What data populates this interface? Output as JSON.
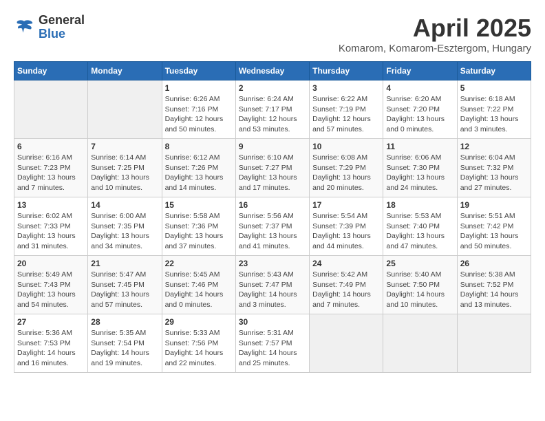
{
  "logo": {
    "general": "General",
    "blue": "Blue"
  },
  "header": {
    "month_year": "April 2025",
    "location": "Komarom, Komarom-Esztergom, Hungary"
  },
  "weekdays": [
    "Sunday",
    "Monday",
    "Tuesday",
    "Wednesday",
    "Thursday",
    "Friday",
    "Saturday"
  ],
  "weeks": [
    [
      {
        "day": "",
        "info": ""
      },
      {
        "day": "",
        "info": ""
      },
      {
        "day": "1",
        "info": "Sunrise: 6:26 AM\nSunset: 7:16 PM\nDaylight: 12 hours\nand 50 minutes."
      },
      {
        "day": "2",
        "info": "Sunrise: 6:24 AM\nSunset: 7:17 PM\nDaylight: 12 hours\nand 53 minutes."
      },
      {
        "day": "3",
        "info": "Sunrise: 6:22 AM\nSunset: 7:19 PM\nDaylight: 12 hours\nand 57 minutes."
      },
      {
        "day": "4",
        "info": "Sunrise: 6:20 AM\nSunset: 7:20 PM\nDaylight: 13 hours\nand 0 minutes."
      },
      {
        "day": "5",
        "info": "Sunrise: 6:18 AM\nSunset: 7:22 PM\nDaylight: 13 hours\nand 3 minutes."
      }
    ],
    [
      {
        "day": "6",
        "info": "Sunrise: 6:16 AM\nSunset: 7:23 PM\nDaylight: 13 hours\nand 7 minutes."
      },
      {
        "day": "7",
        "info": "Sunrise: 6:14 AM\nSunset: 7:25 PM\nDaylight: 13 hours\nand 10 minutes."
      },
      {
        "day": "8",
        "info": "Sunrise: 6:12 AM\nSunset: 7:26 PM\nDaylight: 13 hours\nand 14 minutes."
      },
      {
        "day": "9",
        "info": "Sunrise: 6:10 AM\nSunset: 7:27 PM\nDaylight: 13 hours\nand 17 minutes."
      },
      {
        "day": "10",
        "info": "Sunrise: 6:08 AM\nSunset: 7:29 PM\nDaylight: 13 hours\nand 20 minutes."
      },
      {
        "day": "11",
        "info": "Sunrise: 6:06 AM\nSunset: 7:30 PM\nDaylight: 13 hours\nand 24 minutes."
      },
      {
        "day": "12",
        "info": "Sunrise: 6:04 AM\nSunset: 7:32 PM\nDaylight: 13 hours\nand 27 minutes."
      }
    ],
    [
      {
        "day": "13",
        "info": "Sunrise: 6:02 AM\nSunset: 7:33 PM\nDaylight: 13 hours\nand 31 minutes."
      },
      {
        "day": "14",
        "info": "Sunrise: 6:00 AM\nSunset: 7:35 PM\nDaylight: 13 hours\nand 34 minutes."
      },
      {
        "day": "15",
        "info": "Sunrise: 5:58 AM\nSunset: 7:36 PM\nDaylight: 13 hours\nand 37 minutes."
      },
      {
        "day": "16",
        "info": "Sunrise: 5:56 AM\nSunset: 7:37 PM\nDaylight: 13 hours\nand 41 minutes."
      },
      {
        "day": "17",
        "info": "Sunrise: 5:54 AM\nSunset: 7:39 PM\nDaylight: 13 hours\nand 44 minutes."
      },
      {
        "day": "18",
        "info": "Sunrise: 5:53 AM\nSunset: 7:40 PM\nDaylight: 13 hours\nand 47 minutes."
      },
      {
        "day": "19",
        "info": "Sunrise: 5:51 AM\nSunset: 7:42 PM\nDaylight: 13 hours\nand 50 minutes."
      }
    ],
    [
      {
        "day": "20",
        "info": "Sunrise: 5:49 AM\nSunset: 7:43 PM\nDaylight: 13 hours\nand 54 minutes."
      },
      {
        "day": "21",
        "info": "Sunrise: 5:47 AM\nSunset: 7:45 PM\nDaylight: 13 hours\nand 57 minutes."
      },
      {
        "day": "22",
        "info": "Sunrise: 5:45 AM\nSunset: 7:46 PM\nDaylight: 14 hours\nand 0 minutes."
      },
      {
        "day": "23",
        "info": "Sunrise: 5:43 AM\nSunset: 7:47 PM\nDaylight: 14 hours\nand 3 minutes."
      },
      {
        "day": "24",
        "info": "Sunrise: 5:42 AM\nSunset: 7:49 PM\nDaylight: 14 hours\nand 7 minutes."
      },
      {
        "day": "25",
        "info": "Sunrise: 5:40 AM\nSunset: 7:50 PM\nDaylight: 14 hours\nand 10 minutes."
      },
      {
        "day": "26",
        "info": "Sunrise: 5:38 AM\nSunset: 7:52 PM\nDaylight: 14 hours\nand 13 minutes."
      }
    ],
    [
      {
        "day": "27",
        "info": "Sunrise: 5:36 AM\nSunset: 7:53 PM\nDaylight: 14 hours\nand 16 minutes."
      },
      {
        "day": "28",
        "info": "Sunrise: 5:35 AM\nSunset: 7:54 PM\nDaylight: 14 hours\nand 19 minutes."
      },
      {
        "day": "29",
        "info": "Sunrise: 5:33 AM\nSunset: 7:56 PM\nDaylight: 14 hours\nand 22 minutes."
      },
      {
        "day": "30",
        "info": "Sunrise: 5:31 AM\nSunset: 7:57 PM\nDaylight: 14 hours\nand 25 minutes."
      },
      {
        "day": "",
        "info": ""
      },
      {
        "day": "",
        "info": ""
      },
      {
        "day": "",
        "info": ""
      }
    ]
  ]
}
